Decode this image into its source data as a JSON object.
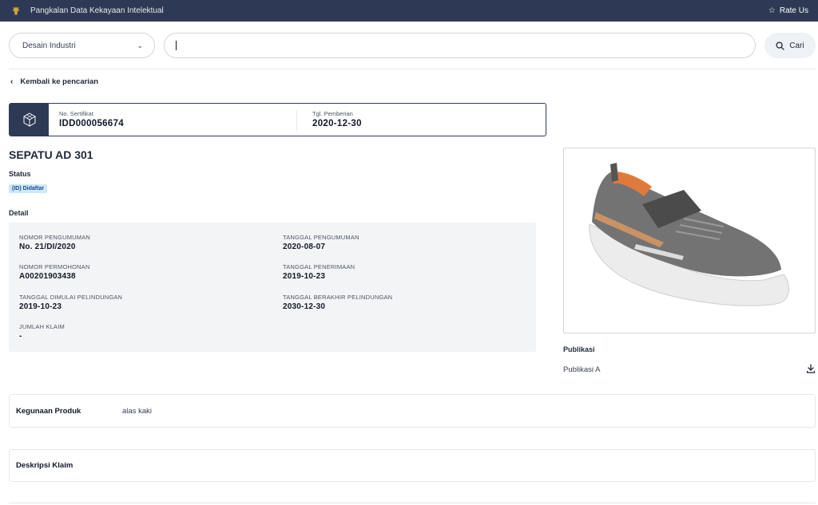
{
  "header": {
    "app_title": "Pangkalan Data Kekayaan Intelektual",
    "rate_label": "Rate Us"
  },
  "search": {
    "type_selected": "Desain Industri",
    "query": "",
    "placeholder": "",
    "button_label": "Cari"
  },
  "back_label": "Kembali ke pencarian",
  "certificate": {
    "no_label": "No. Sertifikat",
    "no_value": "IDD000056674",
    "date_label": "Tgl. Pemberian",
    "date_value": "2020-12-30"
  },
  "title": "SEPATU AD 301",
  "status": {
    "label": "Status",
    "badge": "(ID) Didaftar"
  },
  "detail": {
    "label": "Detail",
    "fields": [
      {
        "key": "NOMOR PENGUMUMAN",
        "value": "No. 21/DI/2020"
      },
      {
        "key": "TANGGAL PENGUMUMAN",
        "value": "2020-08-07"
      },
      {
        "key": "NOMOR PERMOHONAN",
        "value": "A00201903438"
      },
      {
        "key": "TANGGAL PENERIMAAN",
        "value": "2019-10-23"
      },
      {
        "key": "TANGGAL DIMULAI PELINDUNGAN",
        "value": "2019-10-23"
      },
      {
        "key": "TANGGAL BERAKHIR PELINDUNGAN",
        "value": "2030-12-30"
      },
      {
        "key": "JUMLAH KLAIM",
        "value": "-"
      }
    ]
  },
  "publikasi": {
    "label": "Publikasi",
    "items": [
      {
        "label": "Publikasi A"
      }
    ]
  },
  "sections": [
    {
      "label": "Kegunaan Produk",
      "value": "alas kaki"
    },
    {
      "label": "Deskripsi Klaim",
      "value": ""
    }
  ],
  "colors": {
    "navy": "#2e3a55",
    "badge_bg": "#cfe6fb",
    "detail_bg": "#f3f4f6"
  }
}
